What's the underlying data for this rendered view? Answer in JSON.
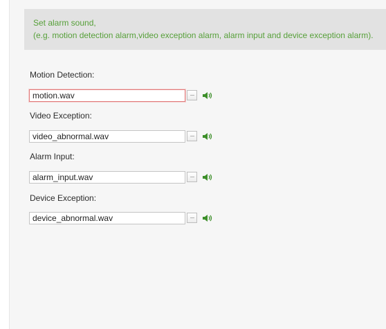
{
  "info": {
    "line1": "Set alarm sound,",
    "line2": "(e.g. motion detection alarm,video exception alarm, alarm input and device exception alarm)."
  },
  "fields": [
    {
      "label": "Motion Detection:",
      "value": "motion.wav",
      "browse_label": "···"
    },
    {
      "label": "Video Exception:",
      "value": "video_abnormal.wav",
      "browse_label": "···"
    },
    {
      "label": "Alarm Input:",
      "value": "alarm_input.wav",
      "browse_label": "···"
    },
    {
      "label": "Device Exception:",
      "value": "device_abnormal.wav",
      "browse_label": "···"
    }
  ],
  "icons": {
    "browse": "ellipsis-icon",
    "play": "speaker-icon"
  },
  "colors": {
    "info_text": "#57a03a",
    "info_background": "#e2e2e2",
    "active_input_border": "#e07b7b",
    "speaker_icon": "#3d8f2a"
  }
}
